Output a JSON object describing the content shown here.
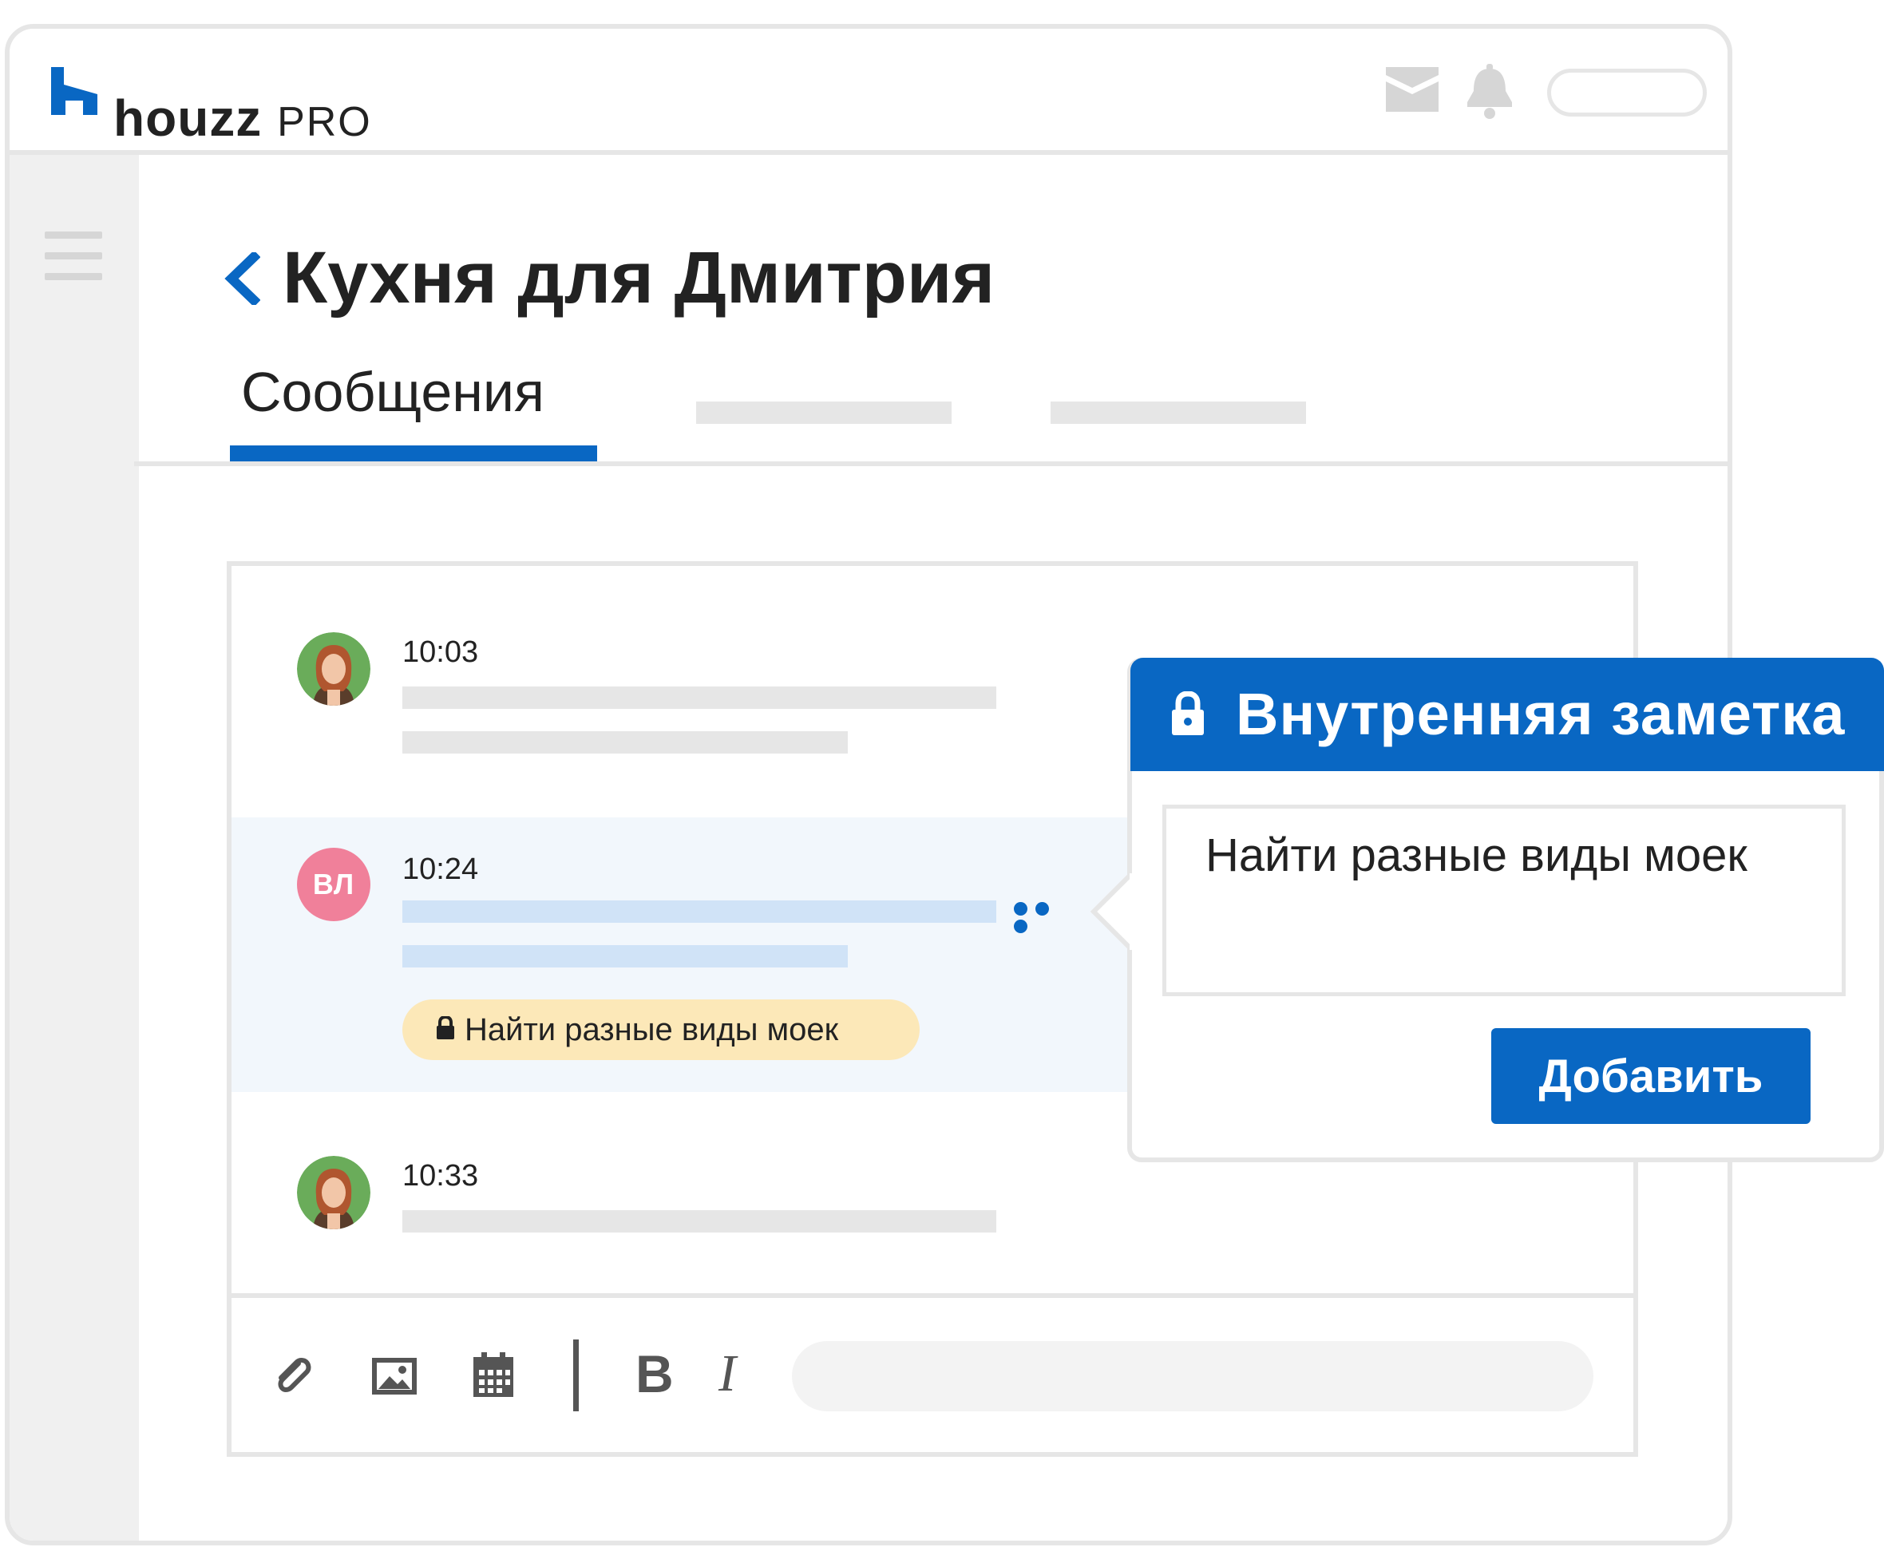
{
  "app": {
    "logo_brand": "houzz",
    "logo_suffix": "PRO",
    "accent_color": "#0967c3"
  },
  "header": {
    "icons": [
      "mail-icon",
      "bell-icon"
    ]
  },
  "page": {
    "title": "Кухня для Дмитрия"
  },
  "tabs": [
    {
      "label": "Сообщения",
      "active": true
    }
  ],
  "messages": [
    {
      "time": "10:03",
      "avatar": "photo"
    },
    {
      "time": "10:24",
      "avatar_initials": "ВЛ",
      "note": "Найти разные виды моек"
    },
    {
      "time": "10:33",
      "avatar": "photo"
    }
  ],
  "composer": {
    "tools": [
      "paperclip-icon",
      "image-icon",
      "calendar-icon"
    ],
    "bold_label": "B",
    "italic_label": "I"
  },
  "note_popup": {
    "title": "Внутренняя заметка",
    "text": "Найти разные виды моек",
    "button_label": "Добавить"
  }
}
